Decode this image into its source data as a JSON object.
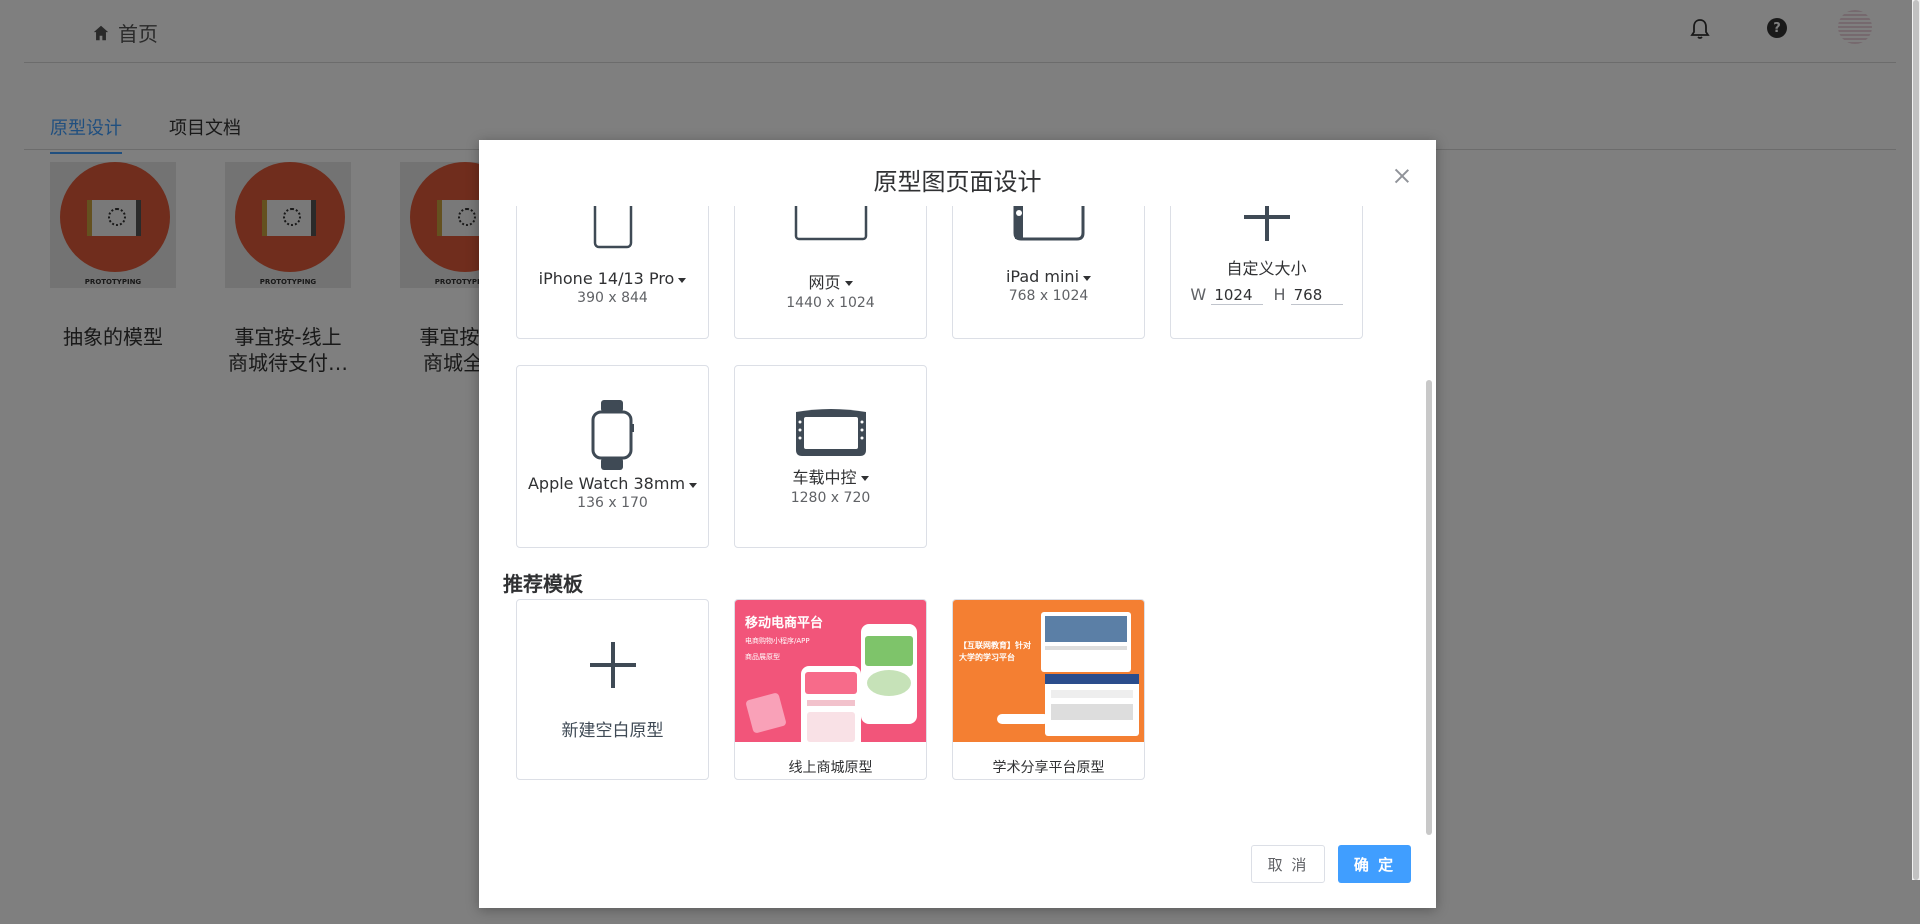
{
  "topbar": {
    "home_label": "首页"
  },
  "tabs": [
    {
      "label": "原型设计"
    },
    {
      "label": "项目文档"
    }
  ],
  "projects": [
    {
      "name_line1": "抽象的模型",
      "name_line2": "",
      "thumb_label": "PROTOTYPING"
    },
    {
      "name_line1": "事宜按-线上",
      "name_line2": "商城待支付…",
      "thumb_label": "PROTOTYPING"
    },
    {
      "name_line1": "事宜按-线",
      "name_line2": "商城全部",
      "thumb_label": "PROTOTYPING"
    }
  ],
  "dialog": {
    "title": "原型图页面设计",
    "devices": [
      {
        "name": "iPhone 14/13 Pro",
        "size": "390 x 844",
        "icon": "phone-icon"
      },
      {
        "name": "网页",
        "size": "1440 x 1024",
        "icon": "monitor-icon"
      },
      {
        "name": "iPad mini",
        "size": "768 x 1024",
        "icon": "tablet-icon"
      },
      {
        "name": "自定义大小",
        "icon": "plus-icon",
        "w_label": "W",
        "w_value": "1024",
        "h_label": "H",
        "h_value": "768"
      },
      {
        "name": "Apple Watch 38mm",
        "size": "136 x 170",
        "icon": "watch-icon"
      },
      {
        "name": "车载中控",
        "size": "1280 x 720",
        "icon": "car-screen-icon"
      }
    ],
    "templates_title": "推荐模板",
    "templates": [
      {
        "label": "新建空白原型",
        "icon": "plus-icon"
      },
      {
        "label": "线上商城原型",
        "banner_title": "移动电商平台",
        "banner_sub1": "电商购物小程序/APP",
        "banner_sub2": "商品展原型"
      },
      {
        "label": "学术分享平台原型",
        "banner_title": "【互联网教育】针对",
        "banner_sub1": "大学的学习平台"
      }
    ],
    "cancel_label": "取 消",
    "ok_label": "确 定"
  },
  "colors": {
    "primary": "#409eff",
    "mall_banner": "#f2557a",
    "edu_banner": "#f47f32"
  }
}
